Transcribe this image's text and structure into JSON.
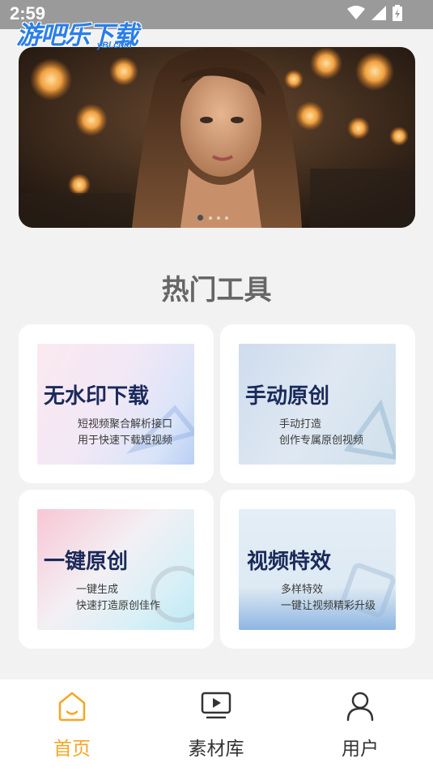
{
  "status_bar": {
    "time": "2:59"
  },
  "watermark": {
    "main": "游吧乐下载",
    "sub": "yBl.com"
  },
  "banner": {
    "slide_count": 4,
    "active_index": 0
  },
  "section": {
    "title": "热门工具"
  },
  "tools": [
    {
      "title": "无水印下载",
      "line1": "短视频聚合解析接口",
      "line2": "用于快速下载短视频"
    },
    {
      "title": "手动原创",
      "line1": "手动打造",
      "line2": "创作专属原创视频"
    },
    {
      "title": "一键原创",
      "line1": "一键生成",
      "line2": "快速打造原创佳作"
    },
    {
      "title": "视频特效",
      "line1": "多样特效",
      "line2": "一键让视频精彩升级"
    }
  ],
  "nav": {
    "items": [
      {
        "label": "首页",
        "icon": "home-icon",
        "active": true
      },
      {
        "label": "素材库",
        "icon": "video-library-icon",
        "active": false
      },
      {
        "label": "用户",
        "icon": "user-icon",
        "active": false
      }
    ],
    "active_color": "#f5a623"
  }
}
